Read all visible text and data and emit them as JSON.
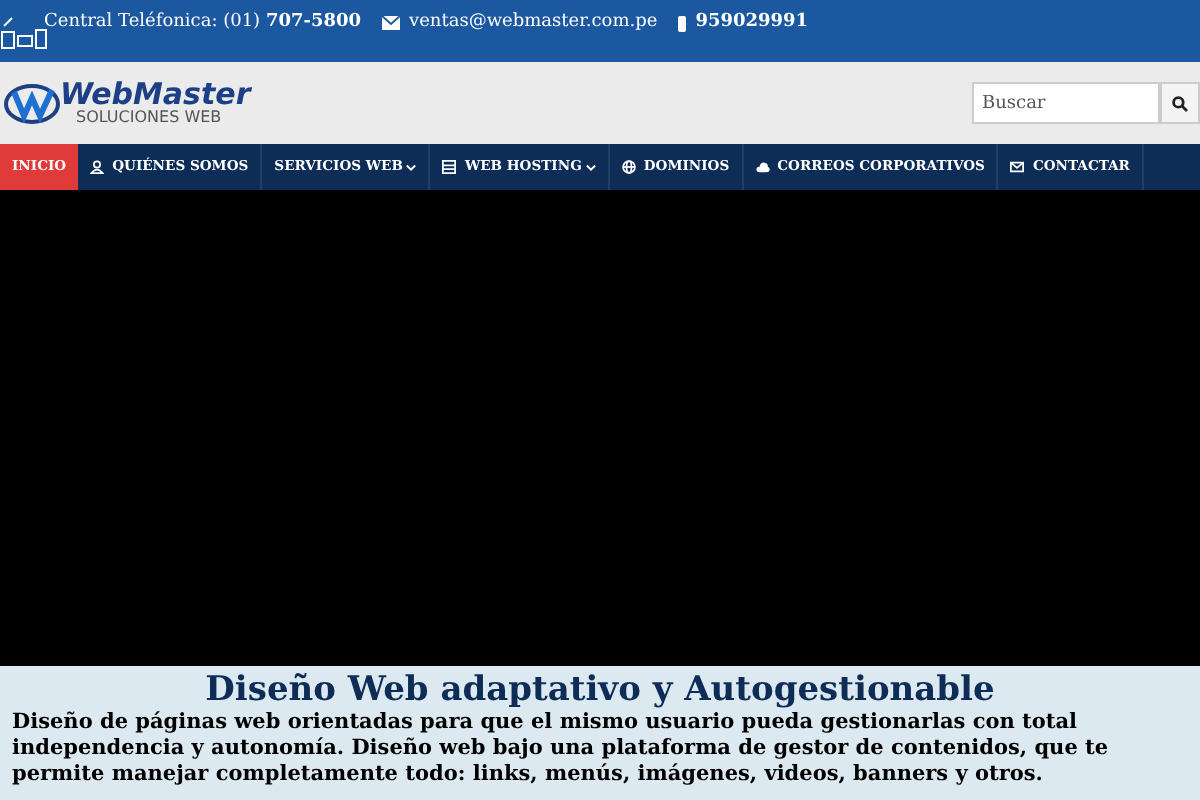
{
  "top_bar": {
    "phone": "Central Teléfonica: (01) **707-5800**",
    "email": "ventas@webmaster.com.pe",
    "mobile": "959029991"
  },
  "logo": {
    "name": "WebMaster",
    "tagline": "SOLUCIONES WEB"
  },
  "search": {
    "placeholder": "Buscar"
  },
  "nav": [
    {
      "label": "INICIO",
      "selected": true,
      "kind": "plain",
      "dropdown": false
    },
    {
      "label": "QUIÉNES SOMOS",
      "selected": false,
      "kind": "user",
      "dropdown": false
    },
    {
      "label": "SERVICIOS WEB",
      "selected": false,
      "kind": "plain",
      "dropdown": true
    },
    {
      "label": "WEB HOSTING",
      "selected": false,
      "kind": "server",
      "dropdown": true
    },
    {
      "label": "DOMINIOS",
      "selected": false,
      "kind": "globe",
      "dropdown": false
    },
    {
      "label": "CORREOS CORPORATIVOS",
      "selected": false,
      "kind": "cloud",
      "dropdown": false
    },
    {
      "label": "CONTACTAR",
      "selected": false,
      "kind": "mail",
      "dropdown": false
    }
  ],
  "hero": {
    "title": "Diseño Web adaptativo y Autogestionable",
    "text": "Diseño de páginas web orientadas para que el mismo usuario pueda gestionarlas con total independencia y autonomía. Diseño web bajo una plataforma de gestor de contenidos, que te permite manejar completamente todo: links, menús, imágenes, videos, banners y otros."
  }
}
